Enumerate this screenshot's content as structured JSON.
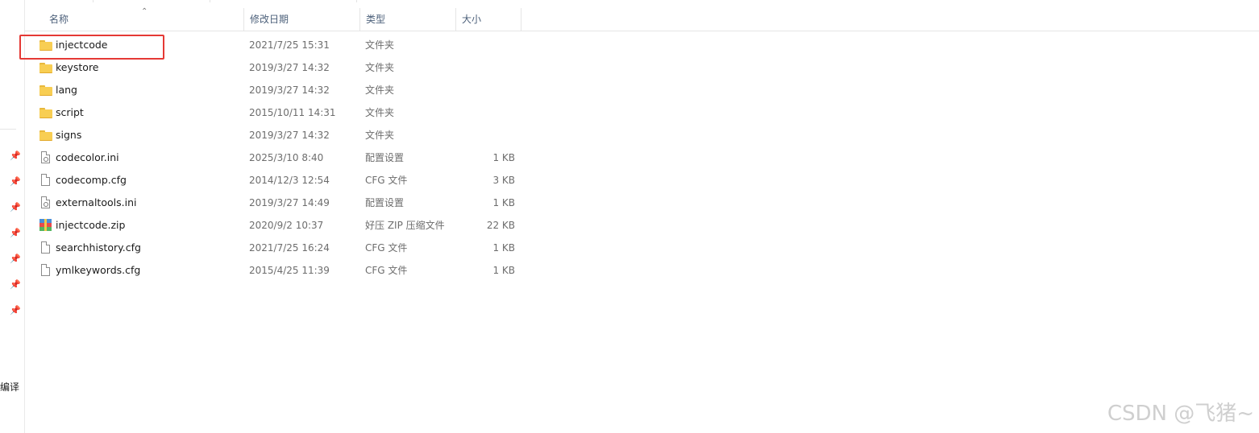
{
  "columns": {
    "name": "名称",
    "date": "修改日期",
    "type": "类型",
    "size": "大小"
  },
  "files": [
    {
      "name": "injectcode",
      "date": "2021/7/25 15:31",
      "type": "文件夹",
      "size": "",
      "icon": "folder-icon"
    },
    {
      "name": "keystore",
      "date": "2019/3/27 14:32",
      "type": "文件夹",
      "size": "",
      "icon": "folder-icon"
    },
    {
      "name": "lang",
      "date": "2019/3/27 14:32",
      "type": "文件夹",
      "size": "",
      "icon": "folder-icon"
    },
    {
      "name": "script",
      "date": "2015/10/11 14:31",
      "type": "文件夹",
      "size": "",
      "icon": "folder-icon"
    },
    {
      "name": "signs",
      "date": "2019/3/27 14:32",
      "type": "文件夹",
      "size": "",
      "icon": "folder-icon"
    },
    {
      "name": "codecolor.ini",
      "date": "2025/3/10 8:40",
      "type": "配置设置",
      "size": "1 KB",
      "icon": "settings-file-icon"
    },
    {
      "name": "codecomp.cfg",
      "date": "2014/12/3 12:54",
      "type": "CFG 文件",
      "size": "3 KB",
      "icon": "file-icon"
    },
    {
      "name": "externaltools.ini",
      "date": "2019/3/27 14:49",
      "type": "配置设置",
      "size": "1 KB",
      "icon": "settings-file-icon"
    },
    {
      "name": "injectcode.zip",
      "date": "2020/9/2 10:37",
      "type": "好压 ZIP 压缩文件",
      "size": "22 KB",
      "icon": "zip-archive-icon"
    },
    {
      "name": "searchhistory.cfg",
      "date": "2021/7/25 16:24",
      "type": "CFG 文件",
      "size": "1 KB",
      "icon": "file-icon"
    },
    {
      "name": "ymlkeywords.cfg",
      "date": "2015/4/25 11:39",
      "type": "CFG 文件",
      "size": "1 KB",
      "icon": "file-icon"
    }
  ],
  "sidebar": {
    "partial_label": "编译"
  },
  "watermark": "CSDN @飞猪~",
  "colors": {
    "highlight": "#e53935",
    "header_text": "#4c607a",
    "folder": "#f8ce53"
  }
}
